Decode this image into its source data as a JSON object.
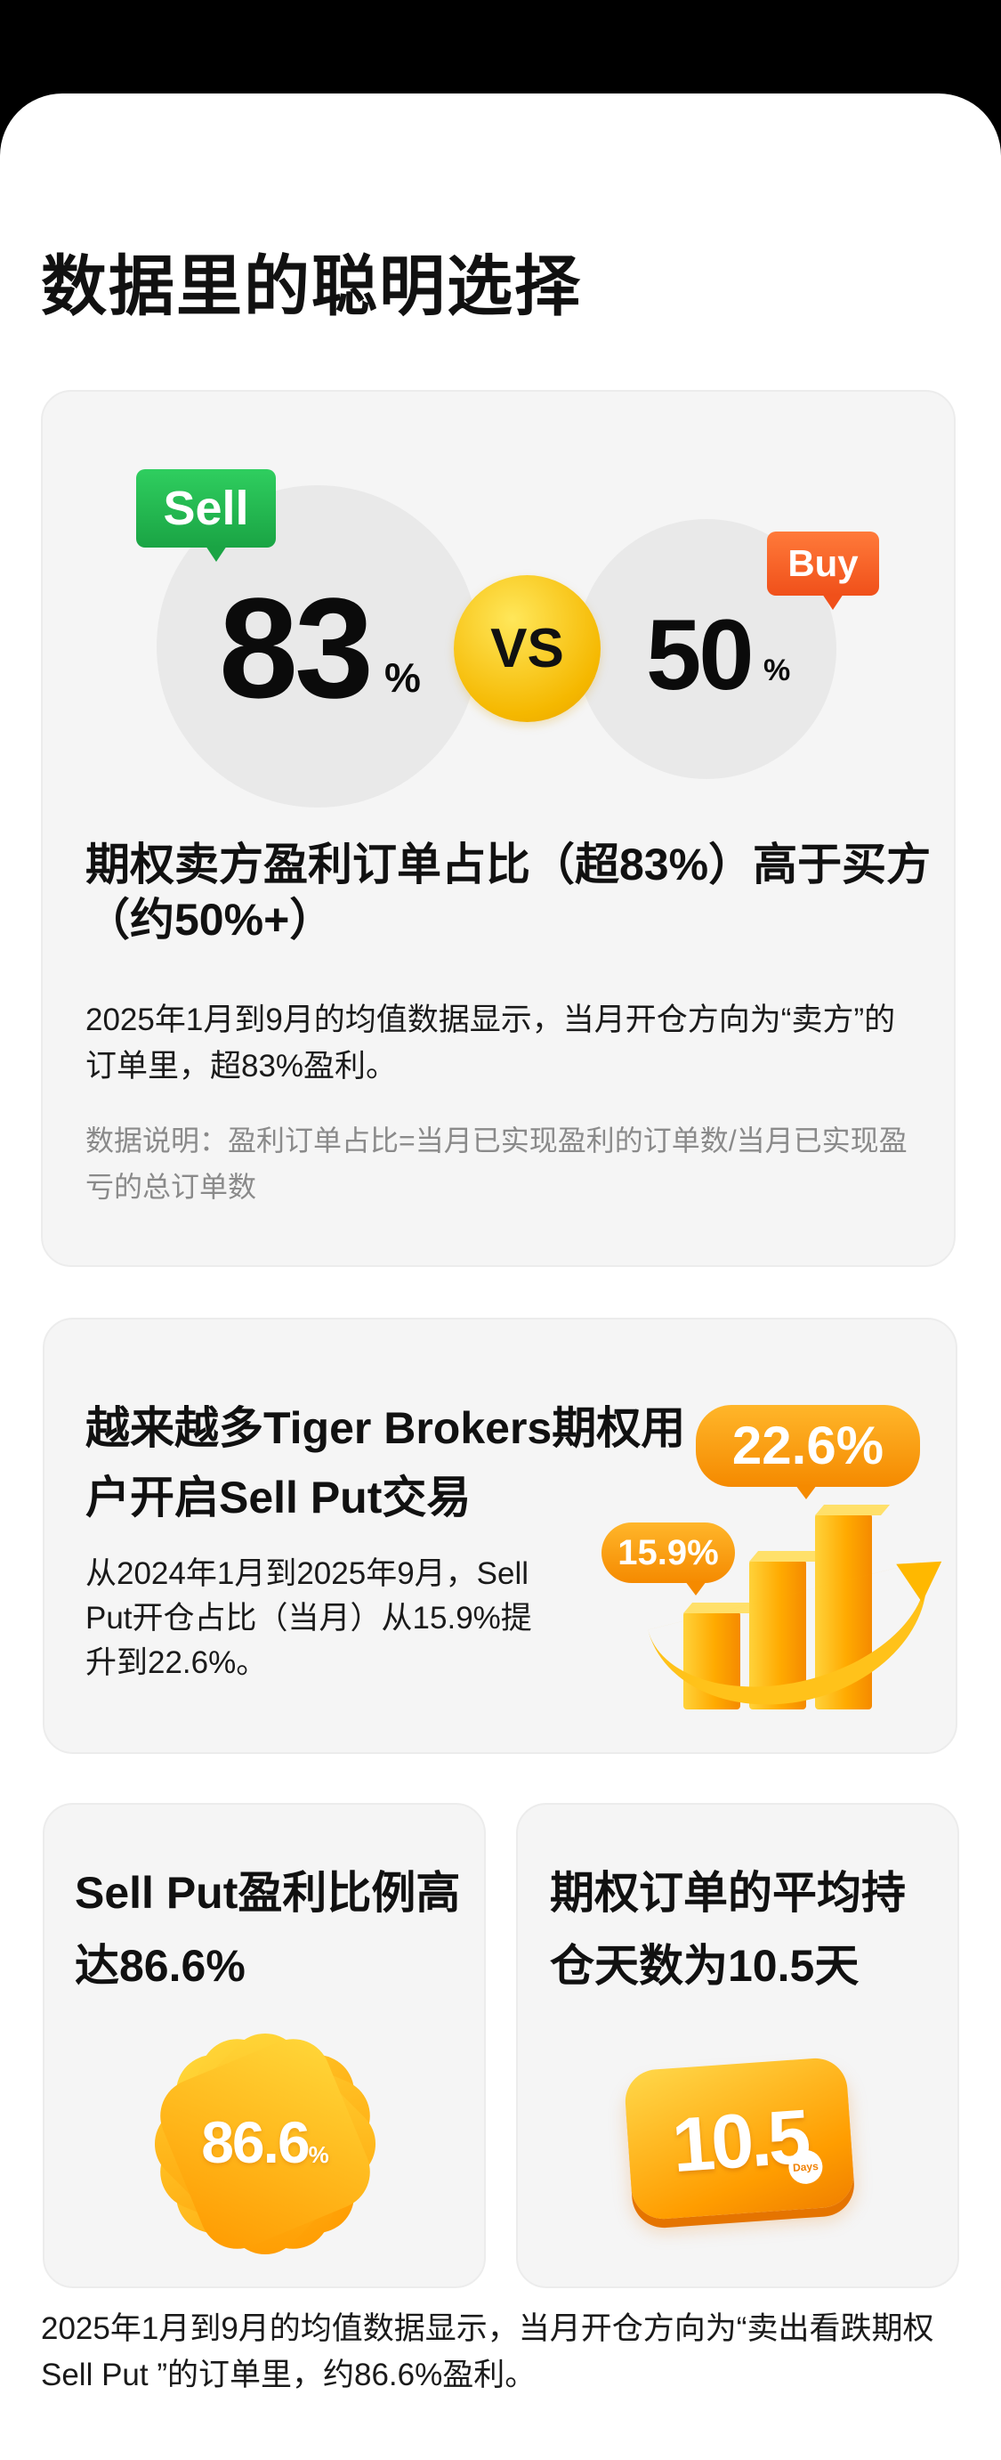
{
  "page": {
    "title": "数据里的聪明选择"
  },
  "card_winrate": {
    "sell_tag": "Sell",
    "buy_tag": "Buy",
    "sell_value": "83",
    "buy_value": "50",
    "percent_sign": "%",
    "vs": "VS",
    "heading": "期权卖方盈利订单占比（超83%）高于买方（约50%+）",
    "body": "2025年1月到9月的均值数据显示，当月开仓方向为“卖方”的订单里，超83%盈利。",
    "note": "数据说明：盈利订单占比=当月已实现盈利的订单数/当月已实现盈亏的总订单数"
  },
  "card_sellput_growth": {
    "heading": "越来越多Tiger Brokers期权用户开启Sell Put交易",
    "body": "从2024年1月到2025年9月，Sell Put开仓占比（当月）从15.9%提升到22.6%。",
    "start_label": "15.9%",
    "end_label": "22.6%"
  },
  "card_sellput_profit": {
    "heading": "Sell Put盈利比例高达86.6%",
    "badge_value": "86.6",
    "badge_unit": "%"
  },
  "card_holding_days": {
    "heading": "期权订单的平均持仓天数为10.5天",
    "tile_value": "10.5",
    "tile_unit": "Days"
  },
  "footer": {
    "text": "2025年1月到9月的均值数据显示，当月开仓方向为“卖出看跌期权Sell Put ”的订单里，约86.6%盈利。"
  },
  "colors": {
    "accent_orange": "#ff9a00",
    "accent_yellow": "#ffd83a",
    "sell_green": "#1aa444",
    "buy_orange": "#f0501a"
  }
}
